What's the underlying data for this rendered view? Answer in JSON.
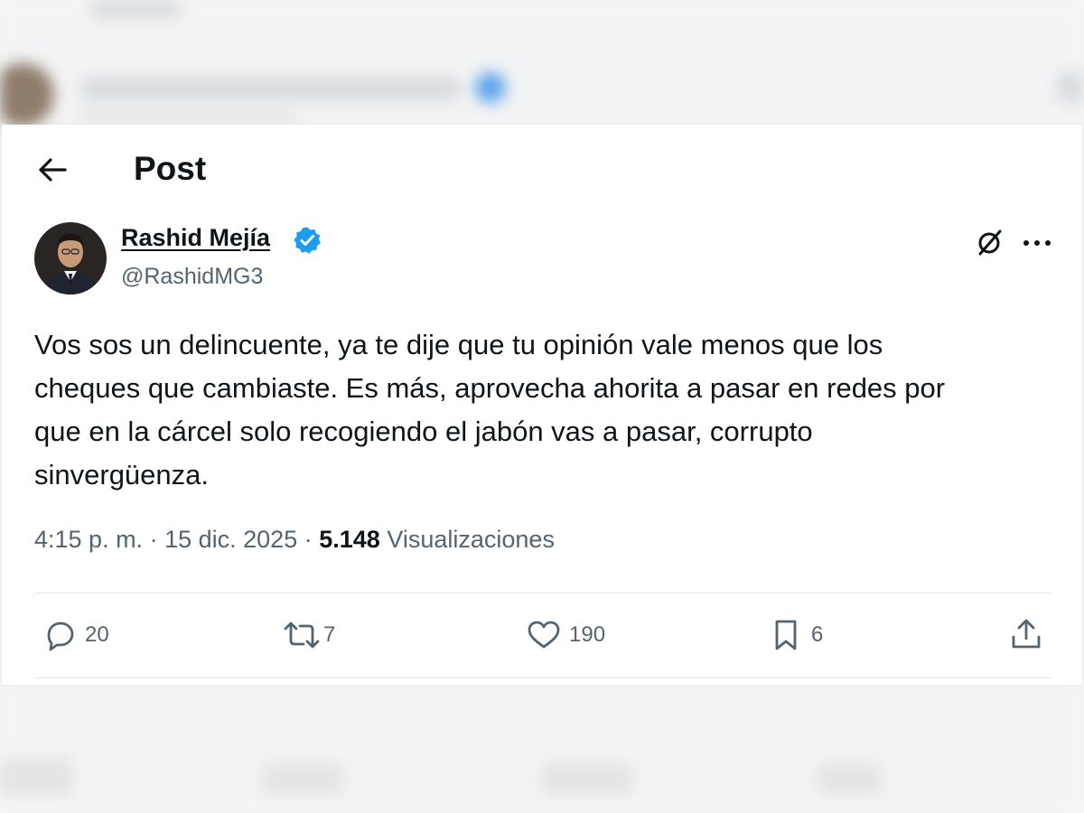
{
  "header": {
    "title": "Post"
  },
  "author": {
    "name": "Rashid Mejía",
    "handle": "@RashidMG3",
    "verified": true
  },
  "post": {
    "text": "Vos sos un delincuente, ya te dije que tu opinión vale menos que los\ncheques que cambiaste. Es más, aprovecha ahorita a pasar en redes por\nque en la cárcel solo recogiendo el jabón vas a pasar, corrupto\nsinvergüenza.",
    "time": "4:15 p. m.",
    "date": "15 dic. 2025",
    "views_count": "5.148",
    "views_label": "Visualizaciones"
  },
  "actions": {
    "replies": "20",
    "reposts": "7",
    "likes": "190",
    "bookmarks": "6"
  },
  "icons": {
    "back": "arrow-left-icon",
    "grok": "grok-icon",
    "more": "more-horizontal-icon",
    "reply": "reply-icon",
    "repost": "repost-icon",
    "like": "heart-icon",
    "bookmark": "bookmark-icon",
    "share": "share-icon",
    "verified": "verified-badge-icon"
  },
  "colors": {
    "text_primary": "#0f1419",
    "text_secondary": "#536471",
    "verified_blue": "#1d9bf0",
    "divider": "#e3e7ea"
  }
}
